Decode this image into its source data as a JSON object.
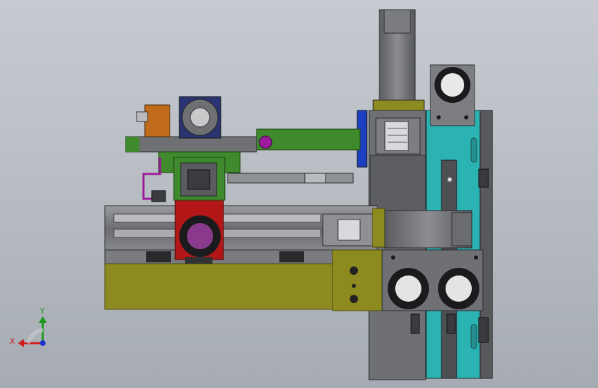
{
  "triad": {
    "x_label": "X",
    "y_label": "Y",
    "x_color": "#d01c1c",
    "y_color": "#1c9a1c",
    "z_color": "#1c2fd0"
  },
  "model": {
    "colors": {
      "frame": "#6e7074",
      "frame_dark": "#45474b",
      "olive": "#8d8a20",
      "olive_dark": "#6d6a14",
      "red": "#b31616",
      "green": "#3f8a2c",
      "teal": "#2bb3b3",
      "navy": "#2a3470",
      "blue": "#1d3fc2",
      "orange": "#c06a1c",
      "purple": "#9c1a9c"
    }
  }
}
